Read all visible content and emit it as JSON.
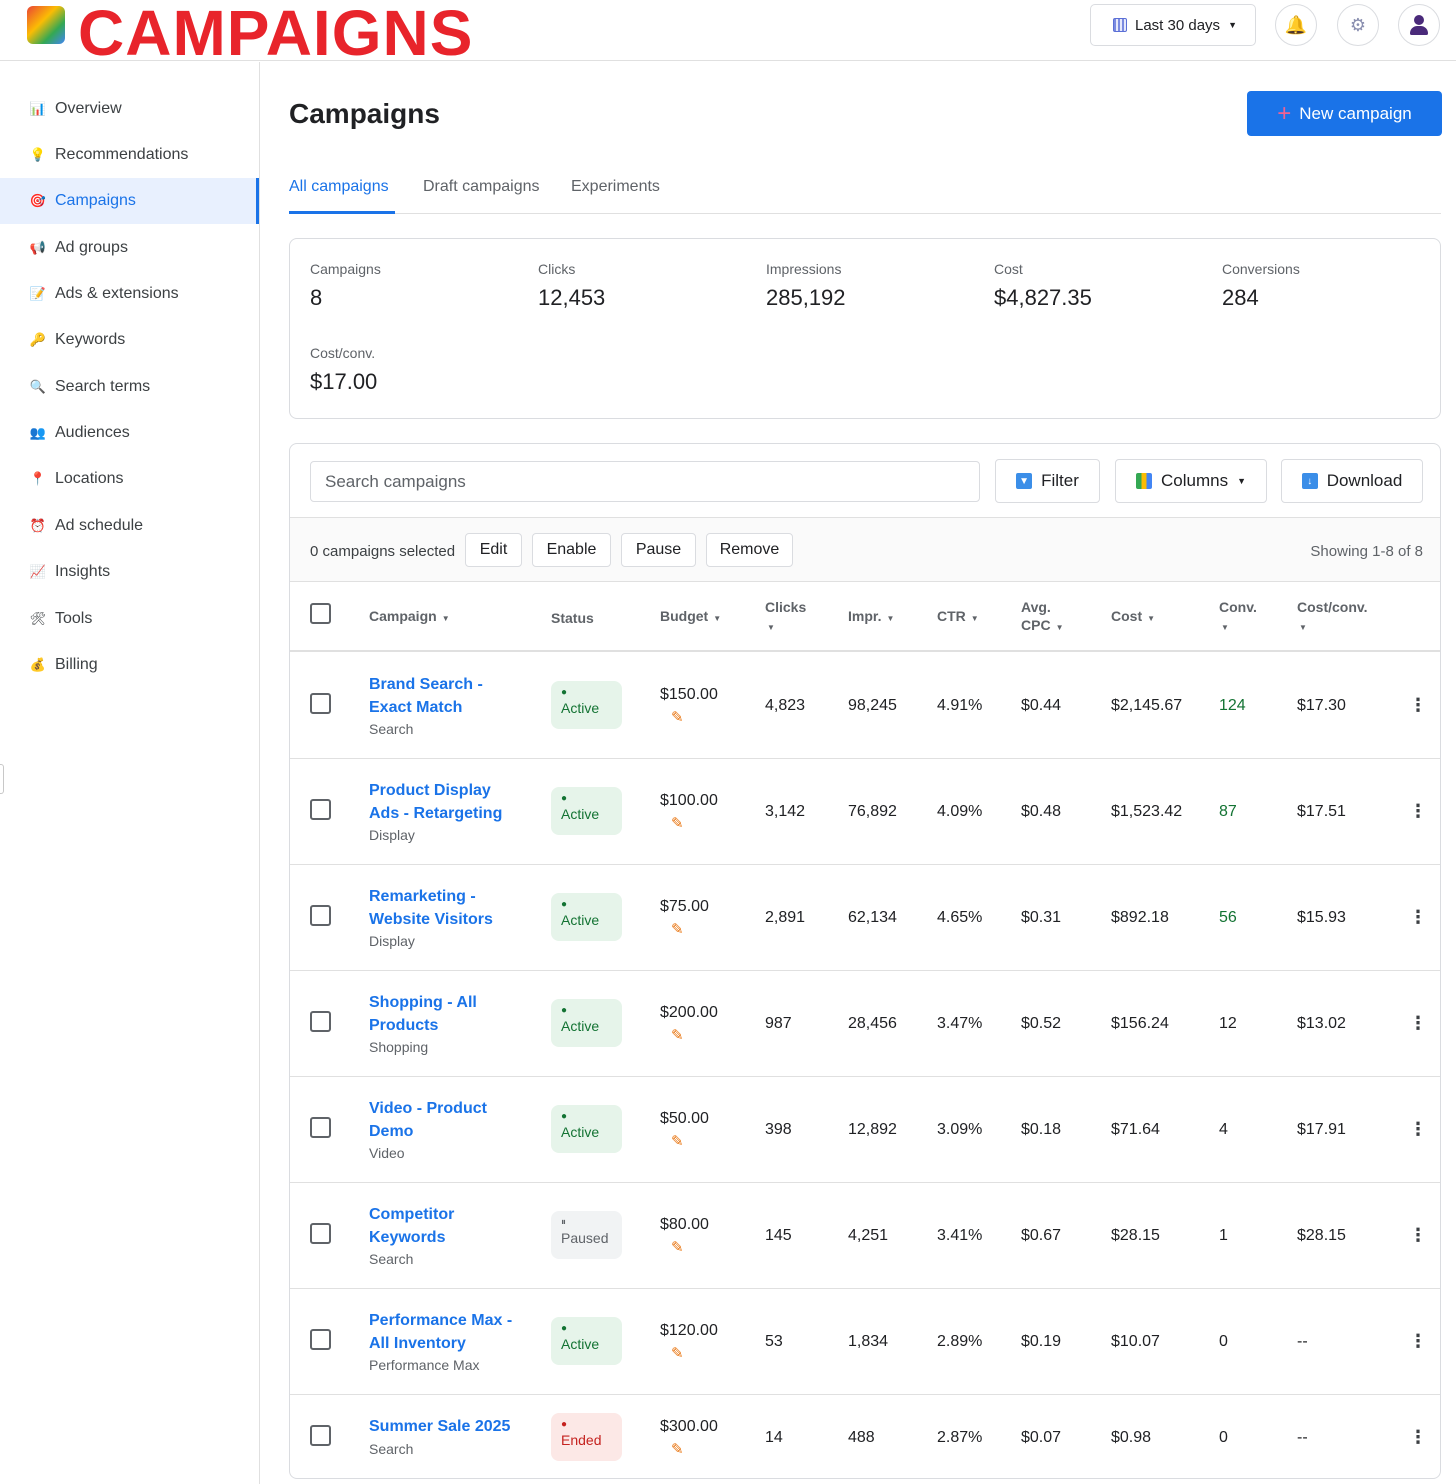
{
  "topbar": {
    "brand": "CAMPAIGNS",
    "date_range": "Last 30 days",
    "icons": [
      "calendar-icon",
      "bell-icon",
      "gear-icon",
      "user-icon"
    ]
  },
  "sidebar": {
    "items": [
      {
        "label": "Overview",
        "icon": "bar-chart-icon"
      },
      {
        "label": "Recommendations",
        "icon": "lightbulb-icon"
      },
      {
        "label": "Campaigns",
        "icon": "target-icon",
        "active": true
      },
      {
        "label": "Ad groups",
        "icon": "megaphone-icon"
      },
      {
        "label": "Ads & extensions",
        "icon": "memo-icon"
      },
      {
        "label": "Keywords",
        "icon": "key-icon"
      },
      {
        "label": "Search terms",
        "icon": "magnifier-icon"
      },
      {
        "label": "Audiences",
        "icon": "people-icon"
      },
      {
        "label": "Locations",
        "icon": "pin-icon"
      },
      {
        "label": "Ad schedule",
        "icon": "alarm-clock-icon"
      },
      {
        "label": "Insights",
        "icon": "trend-chart-icon"
      },
      {
        "label": "Tools",
        "icon": "tools-icon"
      },
      {
        "label": "Billing",
        "icon": "money-bag-icon"
      }
    ]
  },
  "main": {
    "title": "Campaigns",
    "new_button": "New campaign",
    "tabs": [
      "All campaigns",
      "Draft campaigns",
      "Experiments"
    ],
    "summary": [
      {
        "label": "Campaigns",
        "value": "8"
      },
      {
        "label": "Clicks",
        "value": "12,453"
      },
      {
        "label": "Impressions",
        "value": "285,192"
      },
      {
        "label": "Cost",
        "value": "$4,827.35"
      },
      {
        "label": "Conversions",
        "value": "284"
      },
      {
        "label": "Cost/conv.",
        "value": "$17.00"
      }
    ],
    "toolbar": {
      "search_placeholder": "Search campaigns",
      "filter": "Filter",
      "columns": "Columns",
      "download": "Download"
    },
    "bulk": {
      "selected": "0 campaigns selected",
      "actions": [
        "Edit",
        "Enable",
        "Pause",
        "Remove"
      ],
      "showing": "Showing 1-8 of 8"
    },
    "columns": {
      "campaign": "Campaign",
      "status": "Status",
      "budget": "Budget",
      "clicks": "Clicks",
      "impr": "Impr.",
      "ctr": "CTR",
      "avg_cpc_1": "Avg.",
      "avg_cpc_2": "CPC",
      "cost": "Cost",
      "conv": "Conv.",
      "cost_conv": "Cost/conv."
    },
    "rows": [
      {
        "name1": "Brand Search -",
        "name2": "Exact Match",
        "type": "Search",
        "status": "Active",
        "budget": "$150.00",
        "clicks": "4,823",
        "impr": "98,245",
        "ctr": "4.91%",
        "cpc": "$0.44",
        "cost": "$2,145.67",
        "conv": "124",
        "cost_conv": "$17.30"
      },
      {
        "name1": "Product Display",
        "name2": "Ads - Retargeting",
        "type": "Display",
        "status": "Active",
        "budget": "$100.00",
        "clicks": "3,142",
        "impr": "76,892",
        "ctr": "4.09%",
        "cpc": "$0.48",
        "cost": "$1,523.42",
        "conv": "87",
        "cost_conv": "$17.51"
      },
      {
        "name1": "Remarketing -",
        "name2": "Website Visitors",
        "type": "Display",
        "status": "Active",
        "budget": "$75.00",
        "clicks": "2,891",
        "impr": "62,134",
        "ctr": "4.65%",
        "cpc": "$0.31",
        "cost": "$892.18",
        "conv": "56",
        "cost_conv": "$15.93"
      },
      {
        "name1": "Shopping - All",
        "name2": "Products",
        "type": "Shopping",
        "status": "Active",
        "budget": "$200.00",
        "clicks": "987",
        "impr": "28,456",
        "ctr": "3.47%",
        "cpc": "$0.52",
        "cost": "$156.24",
        "conv": "12",
        "cost_conv": "$13.02"
      },
      {
        "name1": "Video - Product",
        "name2": "Demo",
        "type": "Video",
        "status": "Active",
        "budget": "$50.00",
        "clicks": "398",
        "impr": "12,892",
        "ctr": "3.09%",
        "cpc": "$0.18",
        "cost": "$71.64",
        "conv": "4",
        "cost_conv": "$17.91"
      },
      {
        "name1": "Competitor",
        "name2": "Keywords",
        "type": "Search",
        "status": "Paused",
        "budget": "$80.00",
        "clicks": "145",
        "impr": "4,251",
        "ctr": "3.41%",
        "cpc": "$0.67",
        "cost": "$28.15",
        "conv": "1",
        "cost_conv": "$28.15"
      },
      {
        "name1": "Performance Max -",
        "name2": "All Inventory",
        "type": "Performance Max",
        "status": "Active",
        "budget": "$120.00",
        "clicks": "53",
        "impr": "1,834",
        "ctr": "2.89%",
        "cpc": "$0.19",
        "cost": "$10.07",
        "conv": "0",
        "cost_conv": "--"
      },
      {
        "name1": "Summer Sale 2025",
        "name2": "",
        "type": "Search",
        "status": "Ended",
        "budget": "$300.00",
        "clicks": "14",
        "impr": "488",
        "ctr": "2.87%",
        "cpc": "$0.07",
        "cost": "$0.98",
        "conv": "0",
        "cost_conv": "--"
      }
    ]
  },
  "colors": {
    "brand_red": "#e8242b",
    "accent_blue": "#1a73e8",
    "active_green": "#137333",
    "ended_red": "#c5221f"
  }
}
